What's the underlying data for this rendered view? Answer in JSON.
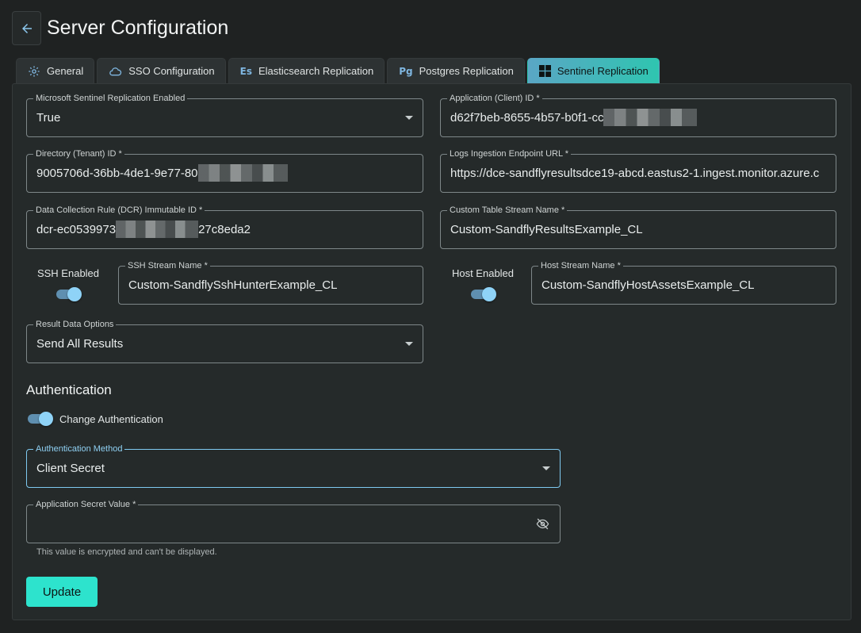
{
  "header": {
    "title": "Server Configuration"
  },
  "tabs": [
    {
      "label": "General",
      "icon": "gear-icon"
    },
    {
      "label": "SSO Configuration",
      "icon": "cloud-lock-icon"
    },
    {
      "label": "Elasticsearch Replication",
      "icon": "elasticsearch-icon",
      "badge": "Es"
    },
    {
      "label": "Postgres Replication",
      "icon": "postgres-icon",
      "badge": "Pg"
    },
    {
      "label": "Sentinel Replication",
      "icon": "windows-icon",
      "active": true
    }
  ],
  "form": {
    "sentinel_enabled": {
      "label": "Microsoft Sentinel Replication Enabled",
      "value": "True"
    },
    "client_id": {
      "label": "Application (Client) ID *",
      "value": "d62f7beb-8655-4b57-b0f1-cc"
    },
    "tenant_id": {
      "label": "Directory (Tenant) ID *",
      "value": "9005706d-36bb-4de1-9e77-80"
    },
    "endpoint_url": {
      "label": "Logs Ingestion Endpoint URL *",
      "value": "https://dce-sandflyresultsdce19-abcd.eastus2-1.ingest.monitor.azure.c"
    },
    "dcr_id": {
      "label": "Data Collection Rule (DCR) Immutable ID *",
      "value_start": "dcr-ec0539973",
      "value_end": "27c8eda2"
    },
    "table_stream": {
      "label": "Custom Table Stream Name *",
      "value": "Custom-SandflyResultsExample_CL"
    },
    "ssh_enabled": {
      "label": "SSH Enabled",
      "on": true
    },
    "ssh_stream": {
      "label": "SSH Stream Name *",
      "value": "Custom-SandflySshHunterExample_CL"
    },
    "host_enabled": {
      "label": "Host Enabled",
      "on": true
    },
    "host_stream": {
      "label": "Host Stream Name *",
      "value": "Custom-SandflyHostAssetsExample_CL"
    },
    "result_options": {
      "label": "Result Data Options",
      "value": "Send All Results"
    }
  },
  "auth": {
    "title": "Authentication",
    "change_label": "Change Authentication",
    "method": {
      "label": "Authentication Method",
      "value": "Client Secret"
    },
    "secret": {
      "label": "Application Secret Value *",
      "value": "",
      "helper": "This value is encrypted and can't be displayed."
    }
  },
  "actions": {
    "update_label": "Update"
  },
  "colors": {
    "accent": "#2de3cd",
    "focus": "#7fc9f0",
    "toggle": "#8fd3f7"
  }
}
